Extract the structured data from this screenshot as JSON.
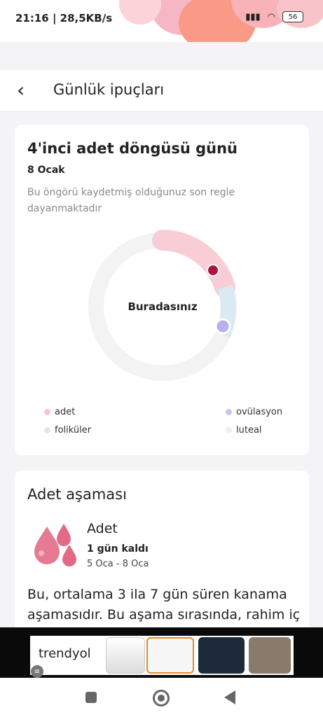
{
  "status": {
    "time_net": "21:16 | 28,5KB/s",
    "battery": "56"
  },
  "header": {
    "title": "Günlük ipuçları"
  },
  "cycle_card": {
    "title": "4'inci adet döngüsü günü",
    "date": "8 Ocak",
    "note": "Bu öngörü kaydetmiş olduğunuz son regle dayanmaktadır",
    "center_label": "Buradasınız",
    "legend": [
      {
        "label": "adet",
        "color": "#f7c5cf"
      },
      {
        "label": "ovülasyon",
        "color": "#c9c4ef"
      },
      {
        "label": "foliküler",
        "color": "#d7e8f3"
      },
      {
        "label": "luteal",
        "color": "#eeeeee"
      }
    ],
    "colors": {
      "menstruation": "#f8cdd6",
      "follicular": "#dbe9f3",
      "luteal": "#f3f3f3",
      "marker_today": "#b0123e",
      "marker_ovulation": "#b6b0ee"
    }
  },
  "phase_card": {
    "title": "Adet aşaması",
    "phase_name": "Adet",
    "days_left": "1 gün kaldı",
    "range": "5 Oca - 8 Oca",
    "body": "Bu, ortalama 3 ila 7 gün süren kanama aşamasıdır. Bu aşama sırasında, rahim iç"
  },
  "ad": {
    "brand": "trendyol"
  }
}
